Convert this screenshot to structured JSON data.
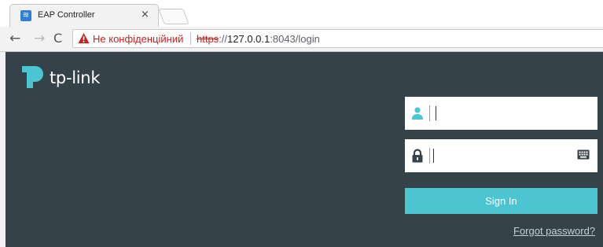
{
  "browser": {
    "tab": {
      "title": "EAP Controller",
      "close_label": "×",
      "favicon": "wifi-icon"
    },
    "nav": {
      "back_icon": "arrow-left-icon",
      "forward_icon": "arrow-right-icon",
      "reload_icon": "reload-icon"
    },
    "address": {
      "security_icon": "warning-triangle-icon",
      "security_text": "Не конфіденційний",
      "scheme": "https",
      "host": "127.0.0.1",
      "rest": ":8043/login"
    }
  },
  "login": {
    "brand": "tp-link",
    "username": {
      "icon": "user-icon",
      "value": "",
      "placeholder": ""
    },
    "password": {
      "icon": "lock-icon",
      "value": "",
      "placeholder": "",
      "keyboard_icon": "keyboard-icon"
    },
    "signin_label": "Sign In",
    "forgot_label": "Forgot password?"
  },
  "colors": {
    "page_bg": "#364249",
    "accent": "#4cc5d2",
    "warning": "#c5221f"
  }
}
